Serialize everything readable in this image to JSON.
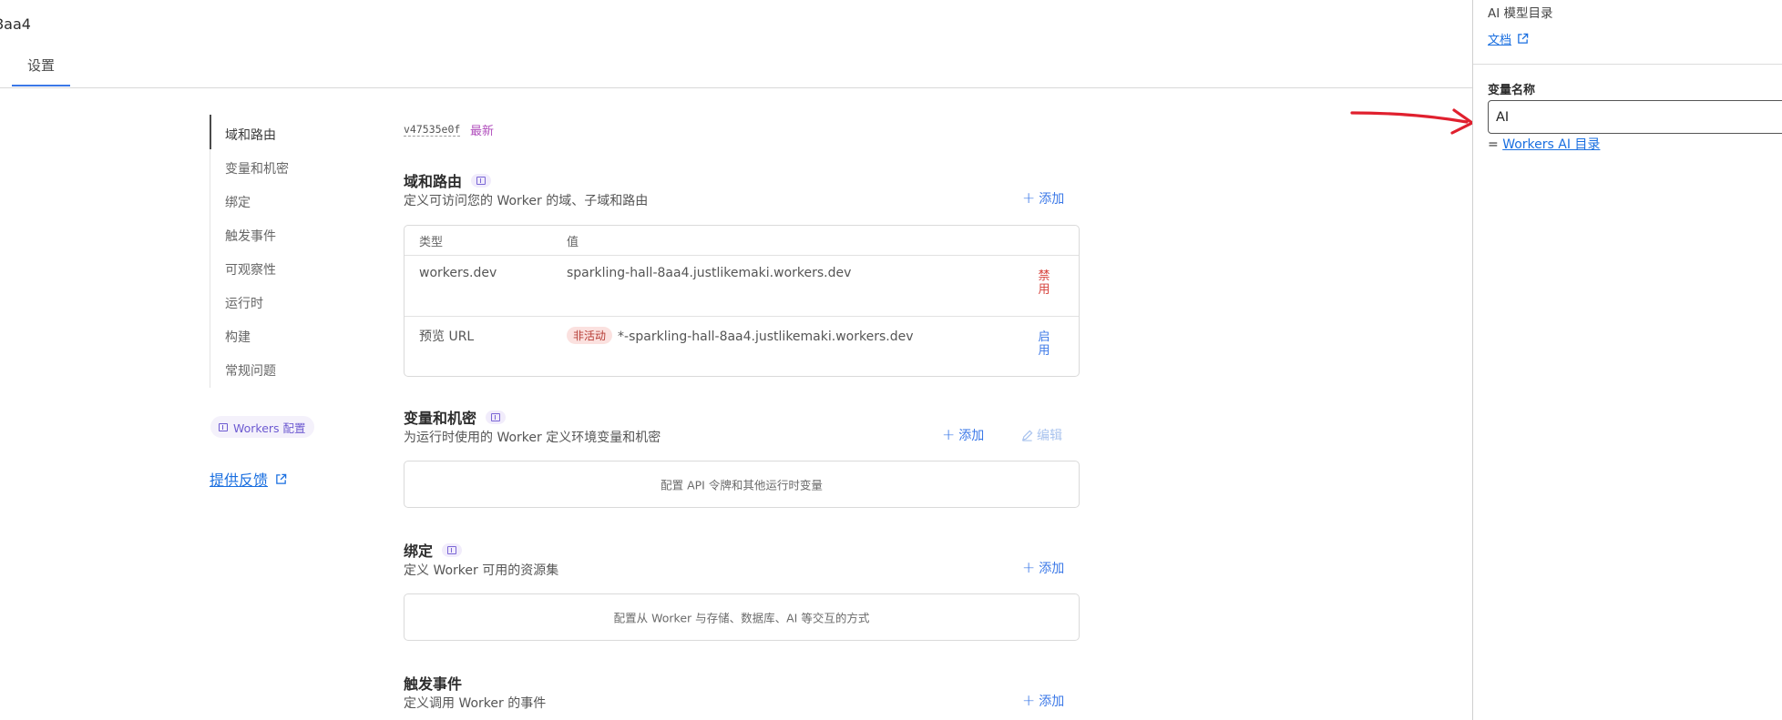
{
  "header": {
    "title": "8aa4",
    "tab_settings": "设置"
  },
  "sidebar": {
    "items": [
      {
        "label": "域和路由",
        "active": true
      },
      {
        "label": "变量和机密"
      },
      {
        "label": "绑定"
      },
      {
        "label": "触发事件"
      },
      {
        "label": "可观察性"
      },
      {
        "label": "运行时"
      },
      {
        "label": "构建"
      },
      {
        "label": "常规问题"
      }
    ],
    "config_pill": "Workers 配置",
    "feedback": "提供反馈"
  },
  "version": {
    "id": "v47535e0f",
    "tag": "最新"
  },
  "domains": {
    "title": "域和路由",
    "subtitle": "定义可访问您的 Worker 的域、子域和路由",
    "add": "添加",
    "columns": [
      "类型",
      "值"
    ],
    "rows": [
      {
        "type": "workers.dev",
        "value": "sparkling-hall-8aa4.justlikemaki.workers.dev",
        "badge": "",
        "action": "禁用"
      },
      {
        "type": "预览 URL",
        "value": "*-sparkling-hall-8aa4.justlikemaki.workers.dev",
        "badge": "非活动",
        "action": "启用"
      }
    ]
  },
  "variables": {
    "title": "变量和机密",
    "subtitle": "为运行时使用的 Worker 定义环境变量和机密",
    "add": "添加",
    "edit": "编辑",
    "empty": "配置 API 令牌和其他运行时变量"
  },
  "bindings": {
    "title": "绑定",
    "subtitle": "定义 Worker 可用的资源集",
    "add": "添加",
    "empty": "配置从 Worker 与存储、数据库、AI 等交互的方式"
  },
  "triggers": {
    "title": "触发事件",
    "subtitle": "定义调用 Worker 的事件",
    "add": "添加"
  },
  "panel": {
    "title": "AI 模型目录",
    "doc_link": "文档",
    "variable_label": "变量名称",
    "variable_value": "AI",
    "catalog_prefix": "=",
    "catalog_link": "Workers AI 目录"
  },
  "colors": {
    "accent": "#3b78e7",
    "danger": "#d6423b",
    "purple": "#b14fbd",
    "arrow": "#e0202e"
  },
  "icons": [
    "external-link-icon",
    "doc-icon",
    "plus-icon",
    "pencil-icon",
    "red-arrow-annotation"
  ]
}
